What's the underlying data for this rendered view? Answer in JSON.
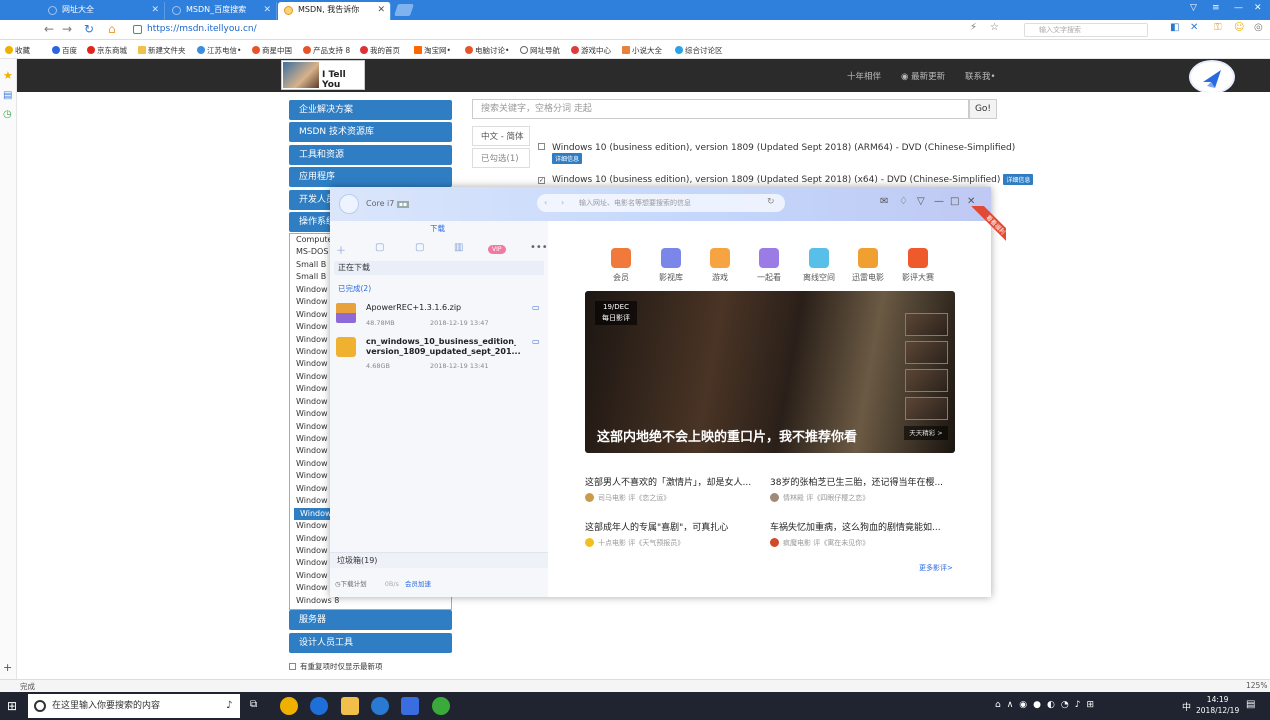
{
  "browser": {
    "tabs": [
      {
        "label": "网址大全",
        "active": false
      },
      {
        "label": "MSDN_百度搜索",
        "active": false
      },
      {
        "label": "MSDN, 我告诉你",
        "active": true
      }
    ],
    "address": "https://msdn.itellyou.cn/",
    "search_placeholder": "输入文字搜索",
    "bookmarks": [
      "收藏",
      "百度",
      "京东商城",
      "新建文件夹",
      "江苏电信•",
      "商星中国",
      "产品支持 8",
      "我的首页",
      "淘宝网•",
      "电脑讨论•",
      "网址导航",
      "游戏中心",
      "小说大全",
      "综合讨论区"
    ],
    "status": "完成",
    "zoom": "125%"
  },
  "site": {
    "logo_text": "I Tell You",
    "nav": [
      "十年相伴",
      "最新更新",
      "联系我•"
    ],
    "menu": [
      "企业解决方案",
      "MSDN 技术资源库",
      "工具和资源",
      "应用程序",
      "开发人员工具",
      "操作系统",
      "服务器",
      "设计人员工具"
    ],
    "os_list": [
      "Computer",
      "MS-DOS",
      "Small B",
      "Small B",
      "Window",
      "Window",
      "Window",
      "Window",
      "Window",
      "Window",
      "Window",
      "Window",
      "Window",
      "Window",
      "Window",
      "Window",
      "Window",
      "Window",
      "Window",
      "Window",
      "Window",
      "Window",
      "Window",
      "Window",
      "Window",
      "Window",
      "Window",
      "Window",
      "Window",
      "Windows 8"
    ],
    "selected_os_index": 22,
    "search_placeholder": "搜索关键字，空格分词 走起",
    "go": "Go!",
    "lang_tabs": [
      "中文 - 简体",
      "已勾选(1)"
    ],
    "files": [
      {
        "name": "Windows 10 (business edition), version 1809 (Updated Sept 2018) (ARM64) - DVD (Chinese-Simplified)",
        "badge": "详细信息",
        "checked": false
      },
      {
        "name": "Windows 10 (business edition), version 1809 (Updated Sept 2018) (x64) - DVD (Chinese-Simplified)",
        "badge": "详细信息",
        "checked": true
      }
    ],
    "option": "有重复项时仅显示最新项"
  },
  "xunlei": {
    "user": "Core i7",
    "search_placeholder": "输入网址、电影名等想要搜索的信息",
    "tab": "下载",
    "downloading": "正在下载",
    "done": "已完成(2)",
    "downloads": [
      {
        "name": "ApowerREC+1.3.1.6.zip",
        "name2": "",
        "size": "48.78MB",
        "time": "2018-12-19 13:47",
        "color": "#e9a23b"
      },
      {
        "name": "cn_windows_10_business_edition_",
        "name2": "version_1809_updated_sept_201...",
        "size": "4.68GB",
        "time": "2018-12-19 13:41",
        "color": "#f0b030"
      }
    ],
    "trash": "垃圾箱(19)",
    "plan": "下载计划",
    "speed": "0B/s",
    "vip": "会员加速",
    "services": [
      {
        "label": "会员",
        "color": "#f07a3c"
      },
      {
        "label": "影视库",
        "color": "#7a86e8"
      },
      {
        "label": "游戏",
        "color": "#f6a441"
      },
      {
        "label": "一起看",
        "color": "#9b7be6"
      },
      {
        "label": "离线空间",
        "color": "#57bfe8"
      },
      {
        "label": "迅雷电影",
        "color": "#f0a030"
      },
      {
        "label": "影评大赛",
        "color": "#ef5a2c"
      }
    ],
    "corner_badge": "看看福利",
    "hero": {
      "date": "19/DEC",
      "date_sub": "每日影评",
      "caption": "这部内地绝不会上映的重口片，我不推荐你看",
      "more": "天天精彩 >"
    },
    "articles": [
      {
        "title": "这部男人不喜欢的「激情片」，却是女人...",
        "author": "司马电影",
        "source": "评《恋之运》",
        "color": "#c99b4a"
      },
      {
        "title": "38岁的张柏芝已生三胎，还记得当年在樱...",
        "author": "情林殿",
        "source": "评《四眼仔樱之恋》",
        "color": "#a08a78"
      },
      {
        "title": "这部成年人的专属\"喜剧\"，可真扎心",
        "author": "十点电影",
        "source": "评《天气预报员》",
        "color": "#f0c020"
      },
      {
        "title": "车祸失忆加重病，这么狗血的剧情竟能如...",
        "author": "疯魔电影",
        "source": "评《寓在未见你》",
        "color": "#d04a2a"
      }
    ],
    "more_comments": "更多影评>"
  },
  "taskbar": {
    "search": "在这里输入你要搜索的内容",
    "time": "14:19",
    "date": "2018/12/19"
  }
}
